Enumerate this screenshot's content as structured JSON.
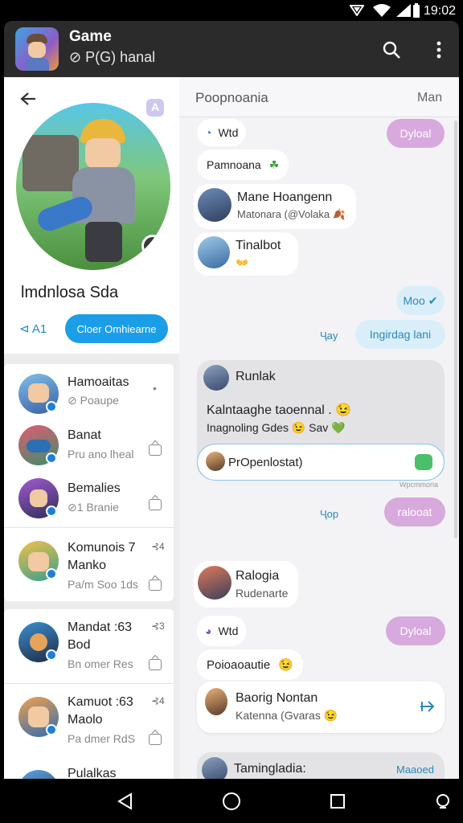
{
  "status_bar": {
    "time": "19:02"
  },
  "app_bar": {
    "title": "Game",
    "subtitle": "⊘ P(G) hanal"
  },
  "profile": {
    "name": "lmdnlosa Sda",
    "count": "⊲ A1",
    "action_label": "Cloer Omhiearne"
  },
  "contacts": [
    {
      "name": "Hamoaitas",
      "sub": "⊘ Poaupe",
      "side": "•"
    },
    {
      "name": "Banat",
      "sub": "Pru ano lheal",
      "side": ""
    },
    {
      "name": "Bemalies",
      "sub": "⊘1 Branie",
      "side": ""
    },
    {
      "name": "Komunois 7",
      "name2": "Manko",
      "sub": "Pa/m Soo 1ds",
      "side": "⊰4"
    },
    {
      "name": "Mandat :63",
      "name2": "Bod",
      "sub": "Bn omer Res",
      "side": "⊰3"
    },
    {
      "name": "Kamuot :63",
      "name2": "Maolo",
      "sub": "Pa dmer RdS",
      "side": "⊰4"
    },
    {
      "name": "Pulalkas",
      "sub": "",
      "side": ""
    }
  ],
  "chat": {
    "header_title": "Poopnoania",
    "header_right": "Man",
    "messages": [
      {
        "kind": "small",
        "text": "Wtd"
      },
      {
        "kind": "pill",
        "text": "Dyloal"
      },
      {
        "kind": "bubble",
        "text": "Pamnoana"
      },
      {
        "kind": "contact",
        "name": "Mane Hoangenn",
        "sub": "Matonara (@Volaka 🍂"
      },
      {
        "kind": "contact",
        "name": "Tinalbot",
        "sub": "👐"
      },
      {
        "kind": "out",
        "text": "Moo"
      },
      {
        "kind": "meta",
        "text": "Ҷay"
      },
      {
        "kind": "out",
        "text": "Ingirdag lani"
      },
      {
        "kind": "card_name",
        "text": "Runlak"
      },
      {
        "kind": "card_line1",
        "text": "Kalntaaghe taoennal . 😉"
      },
      {
        "kind": "card_line2",
        "text": "Inagnoling Gdes 😉 Sav 💚"
      },
      {
        "kind": "input",
        "text": "PrOpenlostat)"
      },
      {
        "kind": "timestamp",
        "text": "Wpcmmoria"
      },
      {
        "kind": "meta",
        "text": "Ҷop"
      },
      {
        "kind": "pill",
        "text": "ralooat"
      },
      {
        "kind": "contact",
        "name": "Ralogia",
        "sub": "Rudenarte"
      },
      {
        "kind": "small",
        "text": "Wtd"
      },
      {
        "kind": "pill",
        "text": "Dyloal"
      },
      {
        "kind": "bubble",
        "text": "Poioaoautie"
      },
      {
        "kind": "contact",
        "name": "Baorig Nontan",
        "sub": "Katenna (Gvaras 😉"
      },
      {
        "kind": "contact",
        "name": "Tamingladia:",
        "sub": "Maaoed"
      }
    ]
  },
  "colors": {
    "accent": "#1a9ee8",
    "purple": "#d7a9dd",
    "bluepill": "#d9eef9"
  },
  "icons": [
    "back-arrow-icon",
    "search-icon",
    "more-vert-icon",
    "wifi-icon",
    "signal-icon",
    "battery-icon",
    "send-icon",
    "chat-icon",
    "nav-back-icon",
    "nav-home-icon",
    "nav-recents-icon"
  ]
}
